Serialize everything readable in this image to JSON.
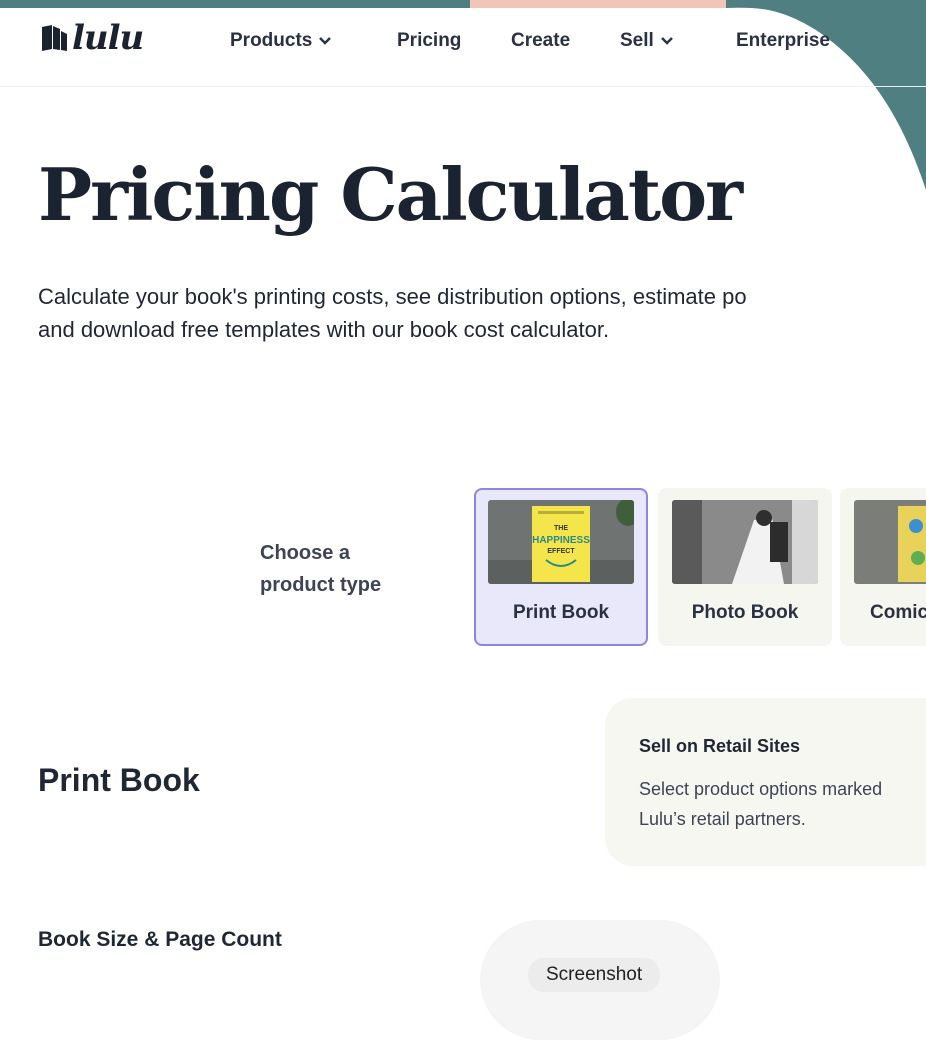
{
  "nav": {
    "logo": "lulu",
    "items": [
      {
        "label": "Products",
        "dropdown": true
      },
      {
        "label": "Pricing",
        "dropdown": false
      },
      {
        "label": "Create",
        "dropdown": false
      },
      {
        "label": "Sell",
        "dropdown": true
      },
      {
        "label": "Enterprise",
        "dropdown": false
      }
    ]
  },
  "hero": {
    "title": "Pricing Calculator",
    "subtitle_line1": "Calculate your book's printing costs, see distribution options, estimate po",
    "subtitle_line2": "and download free templates with our book cost calculator."
  },
  "product_picker": {
    "prompt_line1": "Choose a",
    "prompt_line2": "product type",
    "cards": [
      {
        "label": "Print Book",
        "selected": true,
        "image_text_1": "THE",
        "image_text_2": "HAPPINESS",
        "image_text_3": "EFFECT"
      },
      {
        "label": "Photo Book",
        "selected": false
      },
      {
        "label": "Comic",
        "selected": false
      }
    ]
  },
  "section": {
    "title": "Print Book",
    "retail_title": "Sell on Retail Sites",
    "retail_line1": "Select product options marked",
    "retail_line2": "Lulu’s retail partners.",
    "book_size_heading": "Book Size & Page Count"
  },
  "overlay": {
    "tooltip": "Screenshot"
  },
  "colors": {
    "teal": "#4f7f80",
    "pink": "#f2c5b9",
    "selected_border": "#8c86e0",
    "selected_bg": "#e9e8fa",
    "text_dark": "#1b2230"
  }
}
